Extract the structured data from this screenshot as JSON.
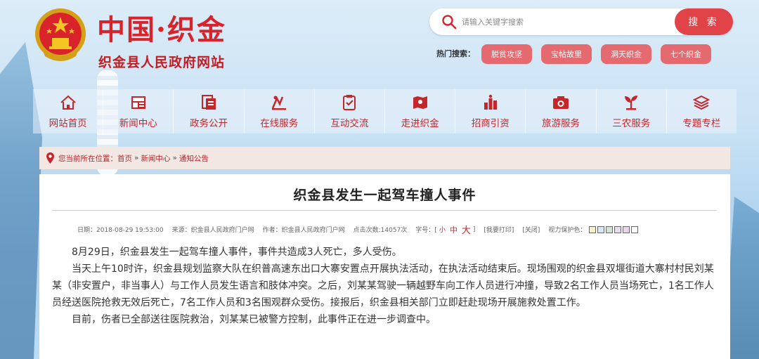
{
  "header": {
    "site_title": "中国·织金",
    "site_subtitle": "织金县人民政府网站"
  },
  "search": {
    "placeholder": "请输入关键字搜索",
    "button_label": "搜 索",
    "hot_label": "热门搜索：",
    "hot_tags": [
      "脱贫攻坚",
      "宝帖故里",
      "洞天织金",
      "七个织金"
    ]
  },
  "nav": {
    "items": [
      {
        "label": "网站首页",
        "icon": "home-icon"
      },
      {
        "label": "新闻中心",
        "icon": "newspaper-icon"
      },
      {
        "label": "政务公开",
        "icon": "document-icon"
      },
      {
        "label": "在线服务",
        "icon": "service-icon"
      },
      {
        "label": "互动交流",
        "icon": "checklist-icon"
      },
      {
        "label": "走进织金",
        "icon": "map-icon"
      },
      {
        "label": "招商引资",
        "icon": "coins-icon"
      },
      {
        "label": "旅游服务",
        "icon": "camera-icon"
      },
      {
        "label": "三农服务",
        "icon": "sprout-icon"
      },
      {
        "label": "专题专栏",
        "icon": "layers-icon"
      }
    ]
  },
  "breadcrumb": {
    "prefix": "您当前所在位置：",
    "items": [
      "首页",
      "新闻中心",
      "通知公告"
    ],
    "separator": "»"
  },
  "article": {
    "title": "织金县发生一起驾车撞人事件",
    "meta": {
      "date": "日期：2018-08-29 19:53:00",
      "source": "来源：织金县人民政府门户网",
      "author": "作者：织金县人民政府门户网",
      "hits": "点击次数:14057次",
      "font_label": "字号：[",
      "font_small": "小",
      "font_mid": "中",
      "font_big": "大",
      "font_close": "]",
      "print": "[我要打印]",
      "close": "[关闭]",
      "eye_label": "视力保护色："
    },
    "swatch_colors": [
      "#f4f0c8",
      "#d6e8f4",
      "#cfe4d2",
      "#e8dcf0",
      "#e8d6ea",
      "#ffffff"
    ],
    "paragraphs": [
      "8月29日，织金县发生一起驾车撞人事件，事件共造成3人死亡，多人受伤。",
      "当天上午10时许，织金县规划监察大队在织普高速东出口大寨安置点开展执法活动，在执法活动结束后。现场围观的织金县双堰街道大寨村村民刘某某（非安置户，非当事人）与工作人员发生语言和肢体冲突。之后，刘某某驾驶一辆越野车向工作人员进行冲撞，导致2名工作人员当场死亡，1名工作人员经送医院抢救无效后死亡，7名工作人员和3名围观群众受伤。接报后，织金县相关部门立即赶赴现场开展施救处置工作。",
      "目前，伤者已全部送往医院救治，刘某某已被警方控制，此事件正在进一步调查中。"
    ]
  },
  "colors": {
    "brand_red": "#d9232a",
    "button_red": "#e04348",
    "tag_pink": "#e46a70",
    "breadcrumb_bg": "#f2e7e3"
  }
}
